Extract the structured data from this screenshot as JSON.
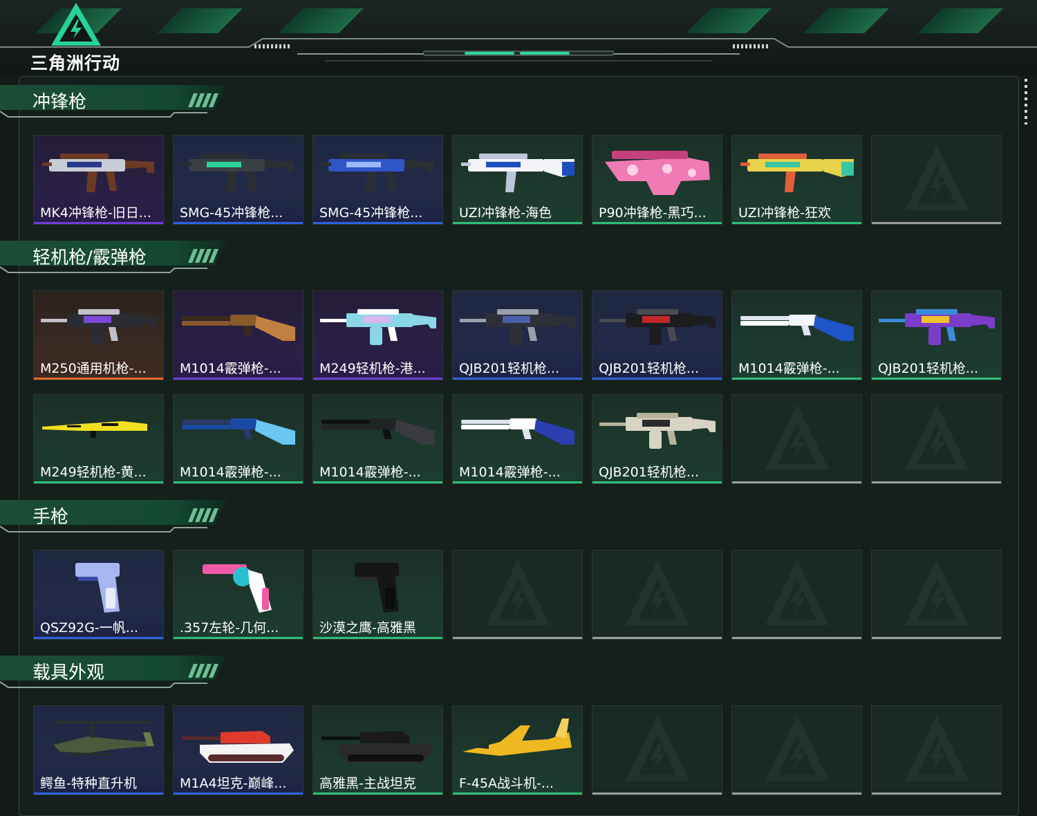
{
  "header": {
    "logo_text": "三角洲行动"
  },
  "sections": [
    {
      "title": "冲锋枪",
      "items": [
        {
          "label": "MK4冲锋枪-旧日...",
          "rarity": "purple",
          "kind": "smg",
          "colors": [
            "#c8ccd6",
            "#2a3a8a",
            "#6b3a24"
          ]
        },
        {
          "label": "SMG-45冲锋枪...",
          "rarity": "blue",
          "kind": "smg",
          "colors": [
            "#3a3f44",
            "#2fd29a",
            "#2b2f33"
          ]
        },
        {
          "label": "SMG-45冲锋枪...",
          "rarity": "blue",
          "kind": "smg",
          "colors": [
            "#2f55c8",
            "#9bb7ff",
            "#2b2f33"
          ]
        },
        {
          "label": "UZI冲锋枪-海色",
          "rarity": "green",
          "kind": "uzi",
          "colors": [
            "#f2f4f8",
            "#1d4fbf",
            "#bcc6d8"
          ]
        },
        {
          "label": "P90冲锋枪-黑巧...",
          "rarity": "green",
          "kind": "p90",
          "colors": [
            "#f07ab4",
            "#ffd0e6",
            "#c7407e"
          ]
        },
        {
          "label": "UZI冲锋枪-狂欢",
          "rarity": "green",
          "kind": "uzi",
          "colors": [
            "#e9d34a",
            "#39c6a2",
            "#e0603a"
          ]
        },
        {
          "empty": true
        }
      ]
    },
    {
      "title": "轻机枪/霰弹枪",
      "items": [
        {
          "label": "M250通用机枪-...",
          "rarity": "orange",
          "kind": "lmg",
          "colors": [
            "#2b2b33",
            "#7c49d6",
            "#c0c0c8"
          ]
        },
        {
          "label": "M1014霰弹枪-...",
          "rarity": "purple",
          "kind": "shotgun",
          "colors": [
            "#8a5a2a",
            "#c08040",
            "#3b2a1a"
          ]
        },
        {
          "label": "M249轻机枪-港...",
          "rarity": "purple",
          "kind": "lmg",
          "colors": [
            "#8ad6e6",
            "#d7b6f0",
            "#ffffff"
          ]
        },
        {
          "label": "QJB201轻机枪...",
          "rarity": "blue",
          "kind": "lmg",
          "colors": [
            "#2e3038",
            "#4a5ea8",
            "#9aa0aa"
          ]
        },
        {
          "label": "QJB201轻机枪...",
          "rarity": "blue",
          "kind": "lmg",
          "colors": [
            "#1d1d20",
            "#c0282a",
            "#4a4a50"
          ]
        },
        {
          "label": "M1014霰弹枪-...",
          "rarity": "green",
          "kind": "shotgun",
          "colors": [
            "#f4f6fa",
            "#1e55c8",
            "#dfe4ee"
          ]
        },
        {
          "label": "QJB201轻机枪...",
          "rarity": "green",
          "kind": "lmg",
          "colors": [
            "#7b3cc8",
            "#f0c030",
            "#3a8ad8"
          ]
        },
        {
          "label": "M249轻机枪-黄...",
          "rarity": "green",
          "kind": "rifle",
          "colors": [
            "#f0e020",
            "#111111",
            "#f0e020"
          ]
        },
        {
          "label": "M1014霰弹枪-...",
          "rarity": "green",
          "kind": "shotgun",
          "colors": [
            "#1a4aa0",
            "#68c8f0",
            "#2a3a6a"
          ]
        },
        {
          "label": "M1014霰弹枪-...",
          "rarity": "green",
          "kind": "shotgun",
          "colors": [
            "#222326",
            "#3a3b40",
            "#111111"
          ]
        },
        {
          "label": "M1014霰弹枪-...",
          "rarity": "green",
          "kind": "shotgun",
          "colors": [
            "#ffffff",
            "#2a3fb0",
            "#dfe3f0"
          ]
        },
        {
          "label": "QJB201轻机枪...",
          "rarity": "green",
          "kind": "lmg",
          "colors": [
            "#d8d4c4",
            "#2a2a2a",
            "#b8b29a"
          ]
        },
        {
          "empty": true
        },
        {
          "empty": true
        }
      ]
    },
    {
      "title": "手枪",
      "items": [
        {
          "label": "QSZ92G-一帆...",
          "rarity": "blue",
          "kind": "pistol",
          "colors": [
            "#a8b6f0",
            "#3a4aa8",
            "#e8ecf8"
          ]
        },
        {
          "label": ".357左轮-几何...",
          "rarity": "green",
          "kind": "revolver",
          "colors": [
            "#f05aa8",
            "#2ac0d0",
            "#ffffff"
          ]
        },
        {
          "label": "沙漠之鹰-高雅黑",
          "rarity": "green",
          "kind": "pistol",
          "colors": [
            "#161616",
            "#2a2a2a",
            "#0c0c0c"
          ]
        },
        {
          "empty": true
        },
        {
          "empty": true
        },
        {
          "empty": true
        },
        {
          "empty": true
        }
      ]
    },
    {
      "title": "载具外观",
      "items": [
        {
          "label": "鳄鱼-特种直升机",
          "rarity": "blue",
          "kind": "heli",
          "colors": [
            "#4a5a3a",
            "#2a3226",
            "#6b7a4a"
          ]
        },
        {
          "label": "M1A4坦克-巅峰...",
          "rarity": "blue",
          "kind": "tank",
          "colors": [
            "#e03a2a",
            "#f4f4f4",
            "#5a2a2a"
          ]
        },
        {
          "label": "高雅黑-主战坦克",
          "rarity": "green",
          "kind": "tank",
          "colors": [
            "#1a1a1a",
            "#2a2a2a",
            "#101010"
          ]
        },
        {
          "label": "F-45A战斗机-...",
          "rarity": "green",
          "kind": "jet",
          "colors": [
            "#f0b820",
            "#2a2a2a",
            "#f0d060"
          ]
        },
        {
          "empty": true
        },
        {
          "empty": true
        },
        {
          "empty": true
        }
      ]
    }
  ]
}
